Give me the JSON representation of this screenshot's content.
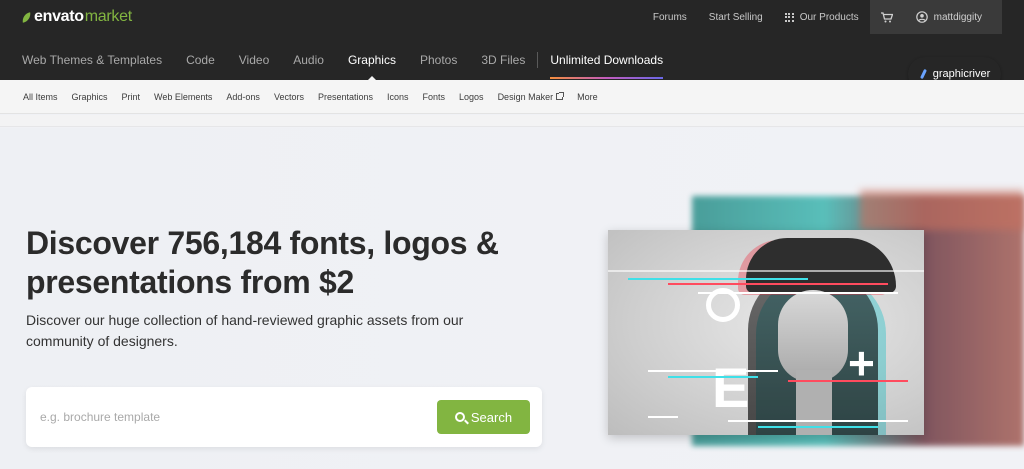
{
  "brand": {
    "name_part1": "envato",
    "name_part2": "market"
  },
  "utility_nav": {
    "forums": "Forums",
    "start_selling": "Start Selling",
    "our_products": "Our Products",
    "username": "mattdiggity"
  },
  "main_nav": {
    "items": [
      "Web Themes & Templates",
      "Code",
      "Video",
      "Audio",
      "Graphics",
      "Photos",
      "3D Files"
    ],
    "active": "Graphics",
    "unlimited": "Unlimited Downloads"
  },
  "site_badge": "graphicriver",
  "sub_nav": {
    "items": [
      "All Items",
      "Graphics",
      "Print",
      "Web Elements",
      "Add-ons",
      "Vectors",
      "Presentations",
      "Icons",
      "Fonts",
      "Logos",
      "Design Maker",
      "More"
    ]
  },
  "hero": {
    "headline": "Discover 756,184 fonts, logos & presentations from $2",
    "subcopy": "Discover our huge collection of hand-reviewed graphic assets from our community of designers."
  },
  "search": {
    "placeholder": "e.g. brochure template",
    "value": "",
    "button_label": "Search"
  },
  "colors": {
    "topbar": "#262626",
    "accent_green": "#82b541",
    "hero_bg": "#f0f1f5"
  }
}
